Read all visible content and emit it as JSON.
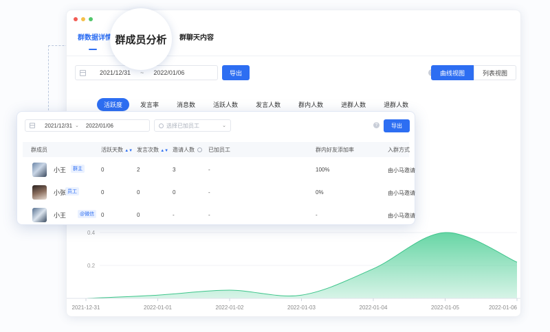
{
  "window": {
    "tabs": [
      {
        "label": "群数据详情",
        "active": true
      },
      {
        "label": "群聊天内容",
        "active": false
      }
    ],
    "callout_title": "群成员分析"
  },
  "filter": {
    "start_date": "2021/12/31",
    "separator": "~",
    "end_date": "2022/01/06",
    "export_label": "导出"
  },
  "view": {
    "help": "?",
    "options": [
      {
        "label": "曲线视图",
        "active": true
      },
      {
        "label": "列表视图",
        "active": false
      }
    ]
  },
  "metrics": [
    {
      "label": "活跃度",
      "active": true
    },
    {
      "label": "发言率",
      "active": false
    },
    {
      "label": "消息数",
      "active": false
    },
    {
      "label": "活跃人数",
      "active": false
    },
    {
      "label": "发言人数",
      "active": false
    },
    {
      "label": "群内人数",
      "active": false
    },
    {
      "label": "进群人数",
      "active": false
    },
    {
      "label": "退群人数",
      "active": false
    }
  ],
  "chart_data": {
    "type": "area",
    "x": [
      "2021-12-31",
      "2022-01-01",
      "2022-01-02",
      "2022-01-03",
      "2022-01-04",
      "2022-01-05",
      "2022-01-06"
    ],
    "y_ticks": [
      "0.4",
      "0.2"
    ],
    "series": [
      {
        "values": [
          0.0,
          0.02,
          0.05,
          0.02,
          0.18,
          0.4,
          0.22
        ]
      }
    ],
    "color": "#5fd3a0"
  },
  "panel": {
    "start_date": "2021/12/31",
    "end_date": "2022/01/06",
    "select_placeholder": "选择已加员工",
    "help": "?",
    "export_label": "导出",
    "headers": [
      "群成员",
      "活跃天数",
      "发言次数",
      "邀请人数",
      "已加员工",
      "群内好友添加率",
      "入群方式"
    ],
    "rows": [
      {
        "name": "小王",
        "role": "群主",
        "active_days": "0",
        "messages": "2",
        "invites": "3",
        "staff": "-",
        "rate": "100%",
        "join": "由小马邀请"
      },
      {
        "name": "小张",
        "role": "员工",
        "active_days": "0",
        "messages": "0",
        "invites": "0",
        "staff": "-",
        "rate": "0%",
        "join": "由小马邀请"
      },
      {
        "name": "小王",
        "role": "@微信",
        "active_days": "0",
        "messages": "0",
        "invites": "-",
        "staff": "-",
        "rate": "-",
        "join": "由小马邀请"
      }
    ]
  },
  "colors": {
    "accent": "#2d6ef2",
    "area": "#5fd3a0"
  }
}
